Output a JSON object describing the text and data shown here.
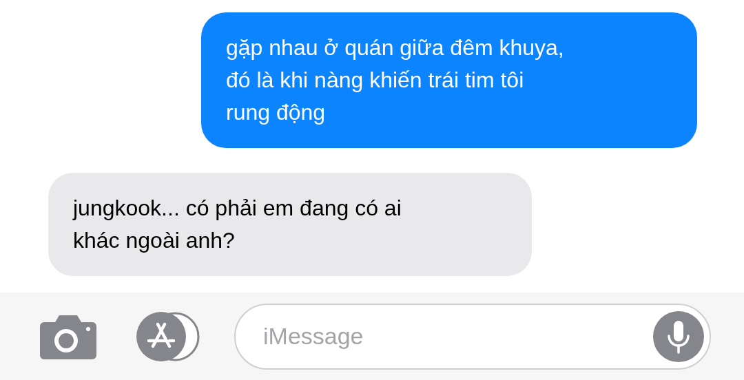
{
  "messages": [
    {
      "kind": "sent",
      "text": "gặp nhau ở quán giữa đêm khuya,\nđó là khi nàng khiến trái tim tôi\nrung động"
    },
    {
      "kind": "received",
      "text": "jungkook... có phải em đang có ai\nkhác ngoài anh?"
    }
  ],
  "compose": {
    "placeholder": "iMessage"
  }
}
